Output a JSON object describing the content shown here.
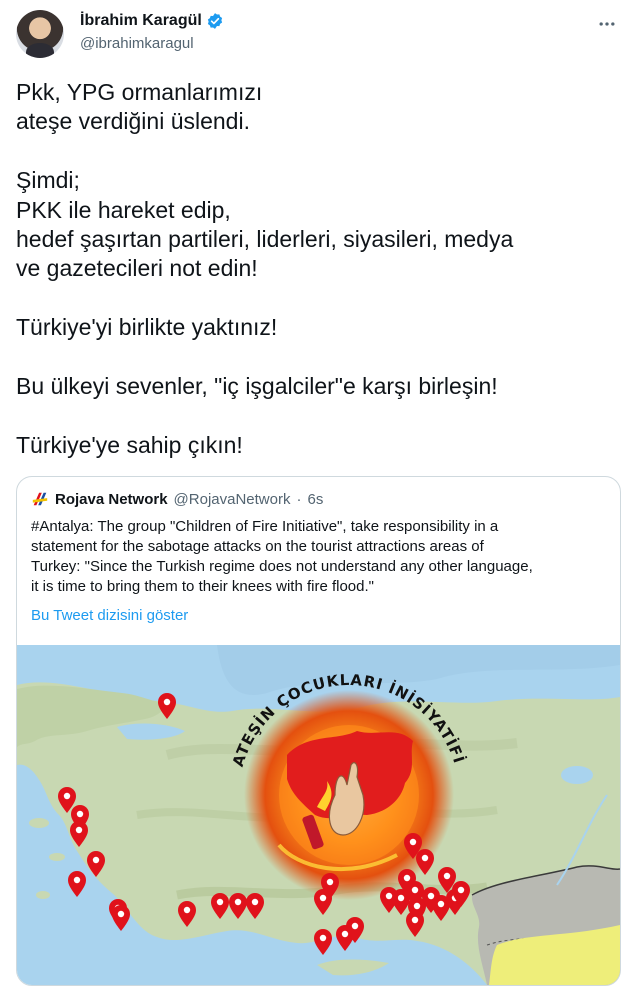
{
  "author": {
    "name": "İbrahim Karagül",
    "handle": "@ibrahimkaragul",
    "verified": true,
    "avatar_icon": "avatar-photo"
  },
  "more_icon": "more-horizontal-icon",
  "tweet": {
    "lines": [
      "Pkk, YPG ormanlarımızı",
      "ateşe verdiğini üslendi.",
      "",
      "Şimdi;",
      "PKK ile hareket edip,",
      "hedef şaşırtan partileri, liderleri, siyasileri, medya",
      "ve gazetecileri not edin!",
      "",
      "Türkiye'yi birlikte yaktınız!",
      "",
      "Bu ülkeyi sevenler, \"iç işgalciler\"e karşı birleşin!",
      "",
      "Türkiye'ye sahip çıkın!"
    ]
  },
  "quoted": {
    "name": "Rojava Network",
    "handle": "@RojavaNetwork",
    "separator": "·",
    "time": "6s",
    "lines": [
      "#Antalya: The group \"Children of Fire Initiative\", take responsibility in a",
      "statement for the sabotage attacks on the tourist attractions areas of",
      "Turkey: \"Since the Turkish regime does not understand any other language,",
      "it is time to bring them to their knees with fire flood.\""
    ],
    "thread_link": "Bu Tweet dizisini göster",
    "image": {
      "emblem_text": "ATEŞİN ÇOCUKLARI İNİSİYATİFİ"
    }
  },
  "colors": {
    "link": "#1d9bf0",
    "verified": "#1d9bf0",
    "pin": "#e0121b",
    "sea": "#a9d3ee"
  }
}
